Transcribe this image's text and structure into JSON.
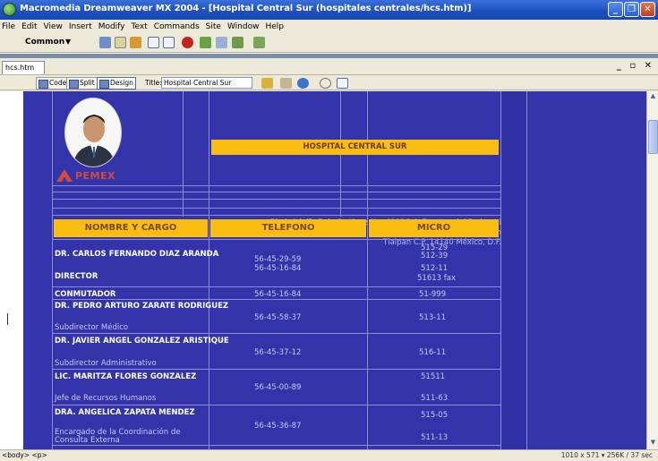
{
  "window": {
    "title": "Macromedia Dreamweaver MX 2004 - [Hospital Central Sur (hospitales centrales/hcs.htm)]"
  },
  "menu": [
    "File",
    "Edit",
    "View",
    "Insert",
    "Modify",
    "Text",
    "Commands",
    "Site",
    "Window",
    "Help"
  ],
  "insert_bar": {
    "category": "Common"
  },
  "document": {
    "tab": "hcs.htm",
    "view_buttons": {
      "code": "Code",
      "split": "Split",
      "design": "Design"
    },
    "title_label": "Title:",
    "title_value": "Hospital Central Sur"
  },
  "page": {
    "heading": "HOSPITAL CENTRAL SUR",
    "logo_text": "PEMEX",
    "address_line1": "Blvd. Adolfo Ruiz Cortinez No. 4091Col. Fuentes del Pedregal Delegación",
    "address_line2": "Tlalpan C.P. 14140 México, D.F.",
    "columns": [
      "NOMBRE Y CARGO",
      "TELEFONO",
      "MICRO"
    ],
    "rows": [
      {
        "name": "DR. CARLOS FERNANDO DIAZ ARANDA",
        "role": "DIRECTOR",
        "phones": [
          "56-45-29-59",
          "56-45-16-84"
        ],
        "micro": [
          "515-29",
          "512-39",
          "512-11",
          "51613 fax"
        ]
      },
      {
        "name": "CONMUTADOR",
        "role": "",
        "phones": [
          "56-45-16-84"
        ],
        "micro": [
          "51-999"
        ]
      },
      {
        "name": "DR. PEDRO ARTURO ZARATE RODRIGUEZ",
        "role": "Subdirector Médico",
        "phones": [
          "56-45-58-37"
        ],
        "micro": [
          "513-11"
        ]
      },
      {
        "name": "DR. JAVIER ANGEL GONZALEZ ARISTIQUE",
        "role": "Subdirector Administrativo",
        "phones": [
          "56-45-37-12"
        ],
        "micro": [
          "516-11"
        ]
      },
      {
        "name": "LIC. MARITZA FLORES GONZALEZ",
        "role": "Jefe de Recursos Humanos",
        "phones": [
          "56-45-00-89"
        ],
        "micro": [
          "51511",
          "511-63"
        ]
      },
      {
        "name": "DRA. ANGELICA ZAPATA MENDEZ",
        "role": "Encargado de la Coordinación de Consulta Externa",
        "phones": [
          "56-45-36-87"
        ],
        "micro": [
          "515-05",
          "511-13"
        ]
      }
    ]
  },
  "status_bar": {
    "tags": "<body> <p>",
    "info": "1010 x 571 ▾ 256K / 37 sec"
  },
  "colors": {
    "page_bg": "#3333aa",
    "header_yellow": "#fbbd0f",
    "titlebar": "#1c4fbd"
  }
}
